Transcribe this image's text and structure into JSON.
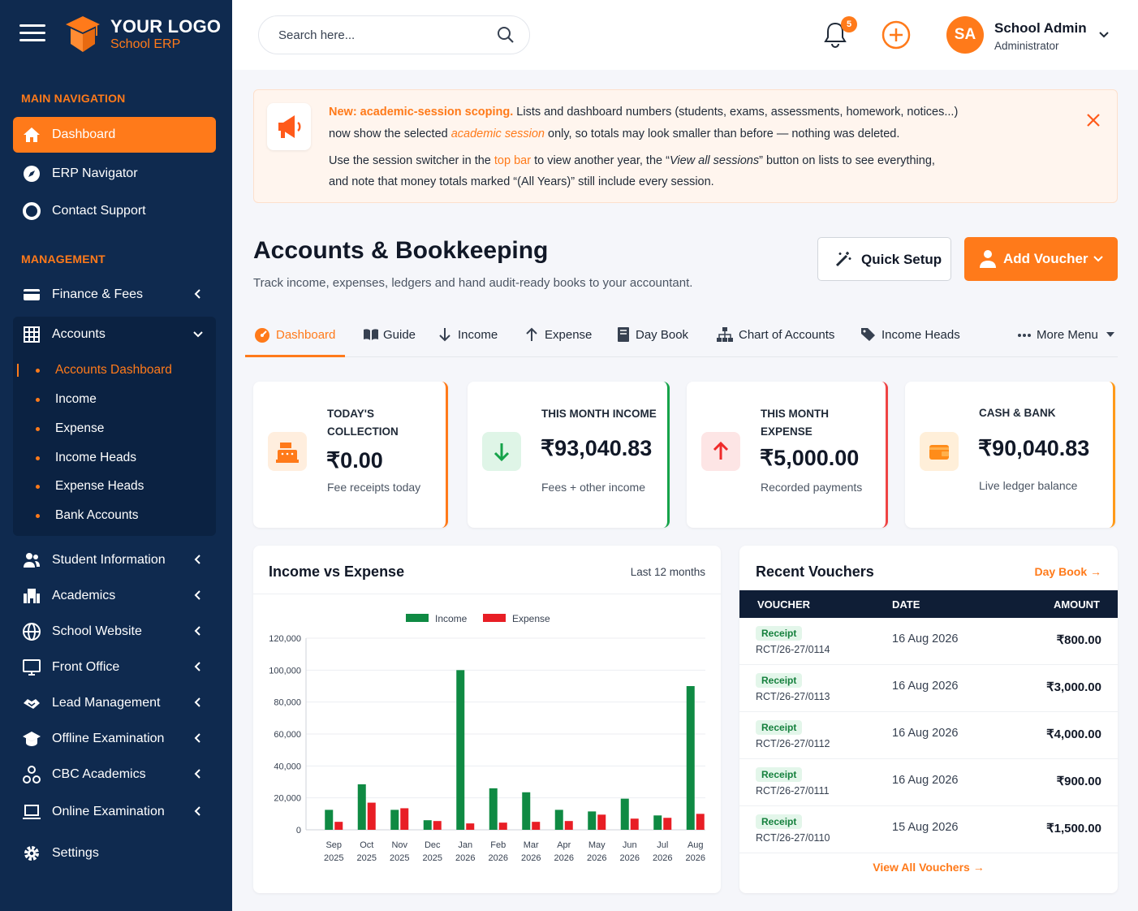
{
  "brand": {
    "logo_text": "YOUR LOGO",
    "app_name": "School ERP"
  },
  "sidebar": {
    "main_title": "MAIN NAVIGATION",
    "main_items": [
      {
        "label": "Dashboard",
        "icon": "home-icon"
      },
      {
        "label": "ERP Navigator",
        "icon": "compass-icon"
      },
      {
        "label": "Contact Support",
        "icon": "lifebuoy-icon"
      }
    ],
    "management_title": "MANAGEMENT",
    "finance": {
      "label": "Finance & Fees",
      "icon": "card-icon"
    },
    "accounts": {
      "label": "Accounts",
      "icon": "grid-icon"
    },
    "accounts_sub": [
      "Accounts Dashboard",
      "Income",
      "Expense",
      "Income Heads",
      "Expense Heads",
      "Bank Accounts"
    ],
    "other_items": [
      {
        "label": "Student Information",
        "icon": "users-icon"
      },
      {
        "label": "Academics",
        "icon": "building-icon"
      },
      {
        "label": "School Website",
        "icon": "globe-icon"
      },
      {
        "label": "Front Office",
        "icon": "monitor-icon"
      },
      {
        "label": "Lead Management",
        "icon": "handshake-icon"
      },
      {
        "label": "Offline Examination",
        "icon": "graduation-cap-icon"
      },
      {
        "label": "CBC Academics",
        "icon": "network-icon"
      },
      {
        "label": "Online Examination",
        "icon": "laptop-icon"
      }
    ],
    "settings": {
      "label": "Settings",
      "icon": "gear-icon"
    }
  },
  "topbar": {
    "search_placeholder": "Search here...",
    "notification_count": "5",
    "user_initials": "SA",
    "user_name": "School Admin",
    "user_role": "Administrator"
  },
  "notice": {
    "headline": "New: academic-session scoping.",
    "line1_rest": " Lists and dashboard numbers (students, exams, assessments, homework, notices...)",
    "line2_a": "now show the selected ",
    "line2_em": "academic session",
    "line2_b": " only, so totals may look smaller than before — nothing was deleted.",
    "line3_a": "Use the session switcher in the ",
    "line3_link": "top bar",
    "line3_b": " to view another year, the “",
    "line3_em": "View all sessions",
    "line3_c": "” button on lists to see everything,",
    "line4": "and note that money totals marked “(All Years)” still include every session."
  },
  "page": {
    "title": "Accounts & Bookkeeping",
    "subtitle": "Track income, expenses, ledgers and hand audit-ready books to your accountant.",
    "quick_setup": "Quick Setup",
    "add_voucher": "Add Voucher"
  },
  "tabs": [
    "Dashboard",
    "Guide",
    "Income",
    "Expense",
    "Day Book",
    "Chart of Accounts",
    "Income Heads",
    "More Menu"
  ],
  "stats": [
    {
      "label1": "TODAY'S",
      "label2": "COLLECTION",
      "value": "₹0.00",
      "note": "Fee receipts today",
      "accent": "#ff7a1a"
    },
    {
      "label1": "THIS MONTH INCOME",
      "label2": "",
      "value": "₹93,040.83",
      "note": "Fees + other income",
      "accent": "#16a34a"
    },
    {
      "label1": "THIS MONTH",
      "label2": "EXPENSE",
      "value": "₹5,000.00",
      "note": "Recorded payments",
      "accent": "#ef4444"
    },
    {
      "label1": "CASH & BANK",
      "label2": "",
      "value": "₹90,040.83",
      "note": "Live ledger balance",
      "accent": "#ff9a1a"
    }
  ],
  "chart": {
    "title": "Income vs Expense",
    "range": "Last 12 months"
  },
  "chart_data": {
    "type": "bar",
    "categories": [
      "Sep 2025",
      "Oct 2025",
      "Nov 2025",
      "Dec 2025",
      "Jan 2026",
      "Feb 2026",
      "Mar 2026",
      "Apr 2026",
      "May 2026",
      "Jun 2026",
      "Jul 2026",
      "Aug 2026"
    ],
    "category_lines": [
      [
        "Sep",
        "2025"
      ],
      [
        "Oct",
        "2025"
      ],
      [
        "Nov",
        "2025"
      ],
      [
        "Dec",
        "2025"
      ],
      [
        "Jan",
        "2026"
      ],
      [
        "Feb",
        "2026"
      ],
      [
        "Mar",
        "2026"
      ],
      [
        "Apr",
        "2026"
      ],
      [
        "May",
        "2026"
      ],
      [
        "Jun",
        "2026"
      ],
      [
        "Jul",
        "2026"
      ],
      [
        "Aug",
        "2026"
      ]
    ],
    "series": [
      {
        "name": "Income",
        "color": "#0f8a43",
        "values": [
          12500,
          28500,
          12500,
          6000,
          100000,
          26000,
          23500,
          12500,
          11500,
          19500,
          9000,
          90000
        ]
      },
      {
        "name": "Expense",
        "color": "#e81e25",
        "values": [
          5000,
          17000,
          13500,
          5500,
          4000,
          4500,
          5000,
          5500,
          9500,
          7000,
          7500,
          10000
        ]
      }
    ],
    "yticks": [
      0,
      20000,
      40000,
      60000,
      80000,
      100000,
      120000
    ],
    "ytick_labels": [
      "0",
      "20,000",
      "40,000",
      "60,000",
      "80,000",
      "100,000",
      "120,000"
    ],
    "ylim": [
      0,
      120000
    ],
    "legend": "top-center",
    "grid": true
  },
  "vouchers": {
    "title": "Recent Vouchers",
    "link": "Day Book →",
    "headers": [
      "VOUCHER",
      "DATE",
      "AMOUNT"
    ],
    "rows": [
      {
        "type": "Receipt",
        "no": "RCT/26-27/0114",
        "date": "16 Aug 2026",
        "amount": "₹800.00"
      },
      {
        "type": "Receipt",
        "no": "RCT/26-27/0113",
        "date": "16 Aug 2026",
        "amount": "₹3,000.00"
      },
      {
        "type": "Receipt",
        "no": "RCT/26-27/0112",
        "date": "16 Aug 2026",
        "amount": "₹4,000.00"
      },
      {
        "type": "Receipt",
        "no": "RCT/26-27/0111",
        "date": "16 Aug 2026",
        "amount": "₹900.00"
      },
      {
        "type": "Receipt",
        "no": "RCT/26-27/0110",
        "date": "15 Aug 2026",
        "amount": "₹1,500.00"
      }
    ],
    "view_all": "View All Vouchers"
  }
}
